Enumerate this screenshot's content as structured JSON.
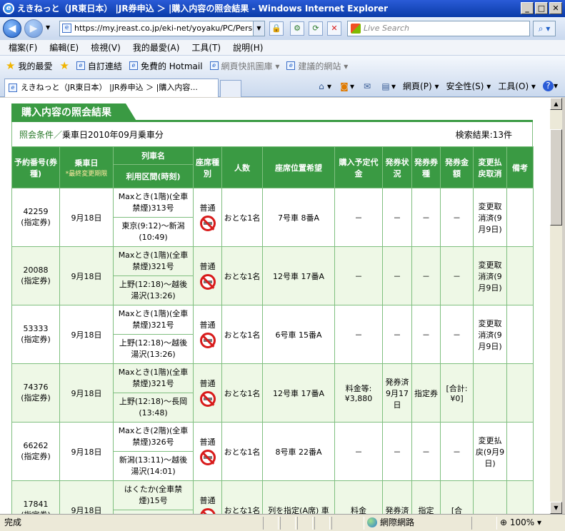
{
  "window": {
    "title": "えきねっと（JR東日本） |JR券申込 ＞ |購入内容の照会結果 - Windows Internet Explorer"
  },
  "address": {
    "url": "https://my.jreast.co.jp/eki-net/yoyaku/PC/Personal/JR"
  },
  "search": {
    "placeholder": "Live Search"
  },
  "menu": [
    "檔案(F)",
    "編輯(E)",
    "檢視(V)",
    "我的最愛(A)",
    "工具(T)",
    "說明(H)"
  ],
  "favorites": {
    "label": "我的最愛",
    "items": [
      "自訂連結",
      "免費的 Hotmail",
      "網頁快訊圖庫 ▾",
      "建議的網站 ▾"
    ]
  },
  "tab": {
    "title": "えきねっと（JR東日本） |JR券申込 ＞ |購入内容..."
  },
  "commands": {
    "page": "網頁(P) ▾",
    "safety": "安全性(S) ▾",
    "tools": "工具(O) ▾"
  },
  "status": {
    "text": "完成",
    "zone": "網際網路",
    "zoom": "100% ▾"
  },
  "page": {
    "section_title": "購入内容の照会結果",
    "condition_label": "照会条件／",
    "condition_value": "乗車日2010年09月乗車分",
    "result_count": "検索結果:13件"
  },
  "table": {
    "headers": {
      "reserve_no": "予約番号(券種)",
      "ride_date": "乗車日",
      "ride_date_note": "*最終変更期限",
      "train": "列車名",
      "route": "利用区間(時刻)",
      "seat_type": "座席種別",
      "people": "人数",
      "seat_pos": "座席位置希望",
      "price": "購入予定代金",
      "issue_status": "発券状況",
      "issue_ticket": "発券券種",
      "issue_amount": "発券金額",
      "change": "変更払戻取消",
      "remarks": "備考"
    },
    "rows": [
      {
        "no": "42259",
        "kind": "(指定券)",
        "date": "9月18日",
        "train": "Maxとき(1階)(全車禁煙)313号",
        "route": "東京(9:12)～新潟(10:49)",
        "seat": "普通",
        "people": "おとな1名",
        "pos": "7号車 8番A",
        "price": "－",
        "status": "－",
        "ticket": "－",
        "amount": "－",
        "change": "変更取消済(9月9日)",
        "remarks": ""
      },
      {
        "no": "20088",
        "kind": "(指定券)",
        "date": "9月18日",
        "train": "Maxとき(1階)(全車禁煙)321号",
        "route": "上野(12:18)～越後湯沢(13:26)",
        "seat": "普通",
        "people": "おとな1名",
        "pos": "12号車 17番A",
        "price": "－",
        "status": "－",
        "ticket": "－",
        "amount": "－",
        "change": "変更取消済(9月9日)",
        "remarks": ""
      },
      {
        "no": "53333",
        "kind": "(指定券)",
        "date": "9月18日",
        "train": "Maxとき(1階)(全車禁煙)321号",
        "route": "上野(12:18)～越後湯沢(13:26)",
        "seat": "普通",
        "people": "おとな1名",
        "pos": "6号車 15番A",
        "price": "－",
        "status": "－",
        "ticket": "－",
        "amount": "－",
        "change": "変更取消済(9月9日)",
        "remarks": ""
      },
      {
        "no": "74376",
        "kind": "(指定券)",
        "date": "9月18日",
        "train": "Maxとき(1階)(全車禁煙)321号",
        "route": "上野(12:18)～長岡(13:48)",
        "seat": "普通",
        "people": "おとな1名",
        "pos": "12号車 17番A",
        "price": "料金等:¥3,880",
        "status": "発券済9月17日",
        "ticket": "指定券",
        "amount": "[合計:¥0]",
        "change": "",
        "remarks": ""
      },
      {
        "no": "66262",
        "kind": "(指定券)",
        "date": "9月18日",
        "train": "Maxとき(2階)(全車禁煙)326号",
        "route": "新潟(13:11)～越後湯沢(14:01)",
        "seat": "普通",
        "people": "おとな1名",
        "pos": "8号車 22番A",
        "price": "－",
        "status": "－",
        "ticket": "－",
        "amount": "－",
        "change": "変更払戻(9月9日)",
        "remarks": ""
      },
      {
        "no": "17841",
        "kind": "(指定券)",
        "date": "9月18日",
        "train": "はくたか(全車禁煙)15号",
        "route": "",
        "seat": "普通",
        "people": "おとな1名",
        "pos": "列を指定(A席) 車",
        "price": "料金",
        "status": "発券済",
        "ticket": "指定",
        "amount": "[合",
        "change": "",
        "remarks": ""
      }
    ]
  }
}
